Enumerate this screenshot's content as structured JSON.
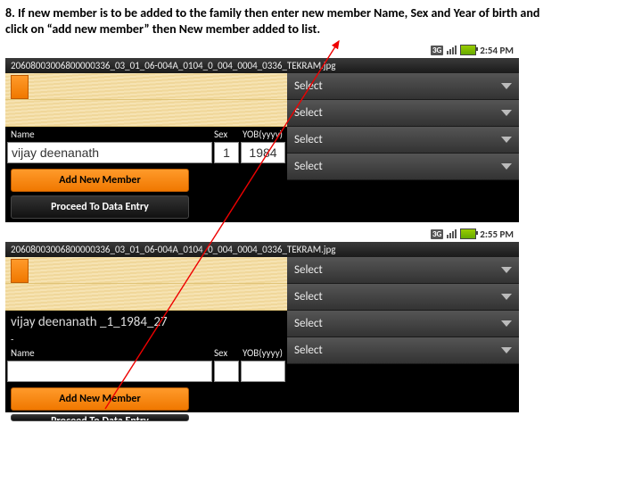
{
  "instruction": "8. If new member is to be added to the family then enter new member Name, Sex and Year of birth and click on “add new member” then New member added to list.",
  "screen_a": {
    "time": "2:54 PM",
    "file": "20608003006800000336_03_01_06-004A_0104_0_004_0004_0336_TEKRAM.jpg",
    "labels": {
      "name": "Name",
      "sex": "Sex",
      "yob": "YOB(yyyy)"
    },
    "inputs": {
      "name": "vijay deenanath",
      "sex": "1",
      "yob": "1984"
    },
    "btn_add": "Add New Member",
    "btn_proceed": "Proceed To Data Entry",
    "select_label": "Select"
  },
  "screen_b": {
    "time": "2:55 PM",
    "file": "20608003006800000336_03_01_06-004A_0104_0_004_0004_0336_TEKRAM.jpg",
    "added_member": "vijay deenanath _1_1984_27",
    "labels": {
      "name": "Name",
      "sex": "Sex",
      "yob": "YOB(yyyy)"
    },
    "inputs": {
      "name": "",
      "sex": "",
      "yob": ""
    },
    "btn_add": "Add New Member",
    "btn_proceed": "Proceed To Data Entry",
    "select_label": "Select"
  }
}
